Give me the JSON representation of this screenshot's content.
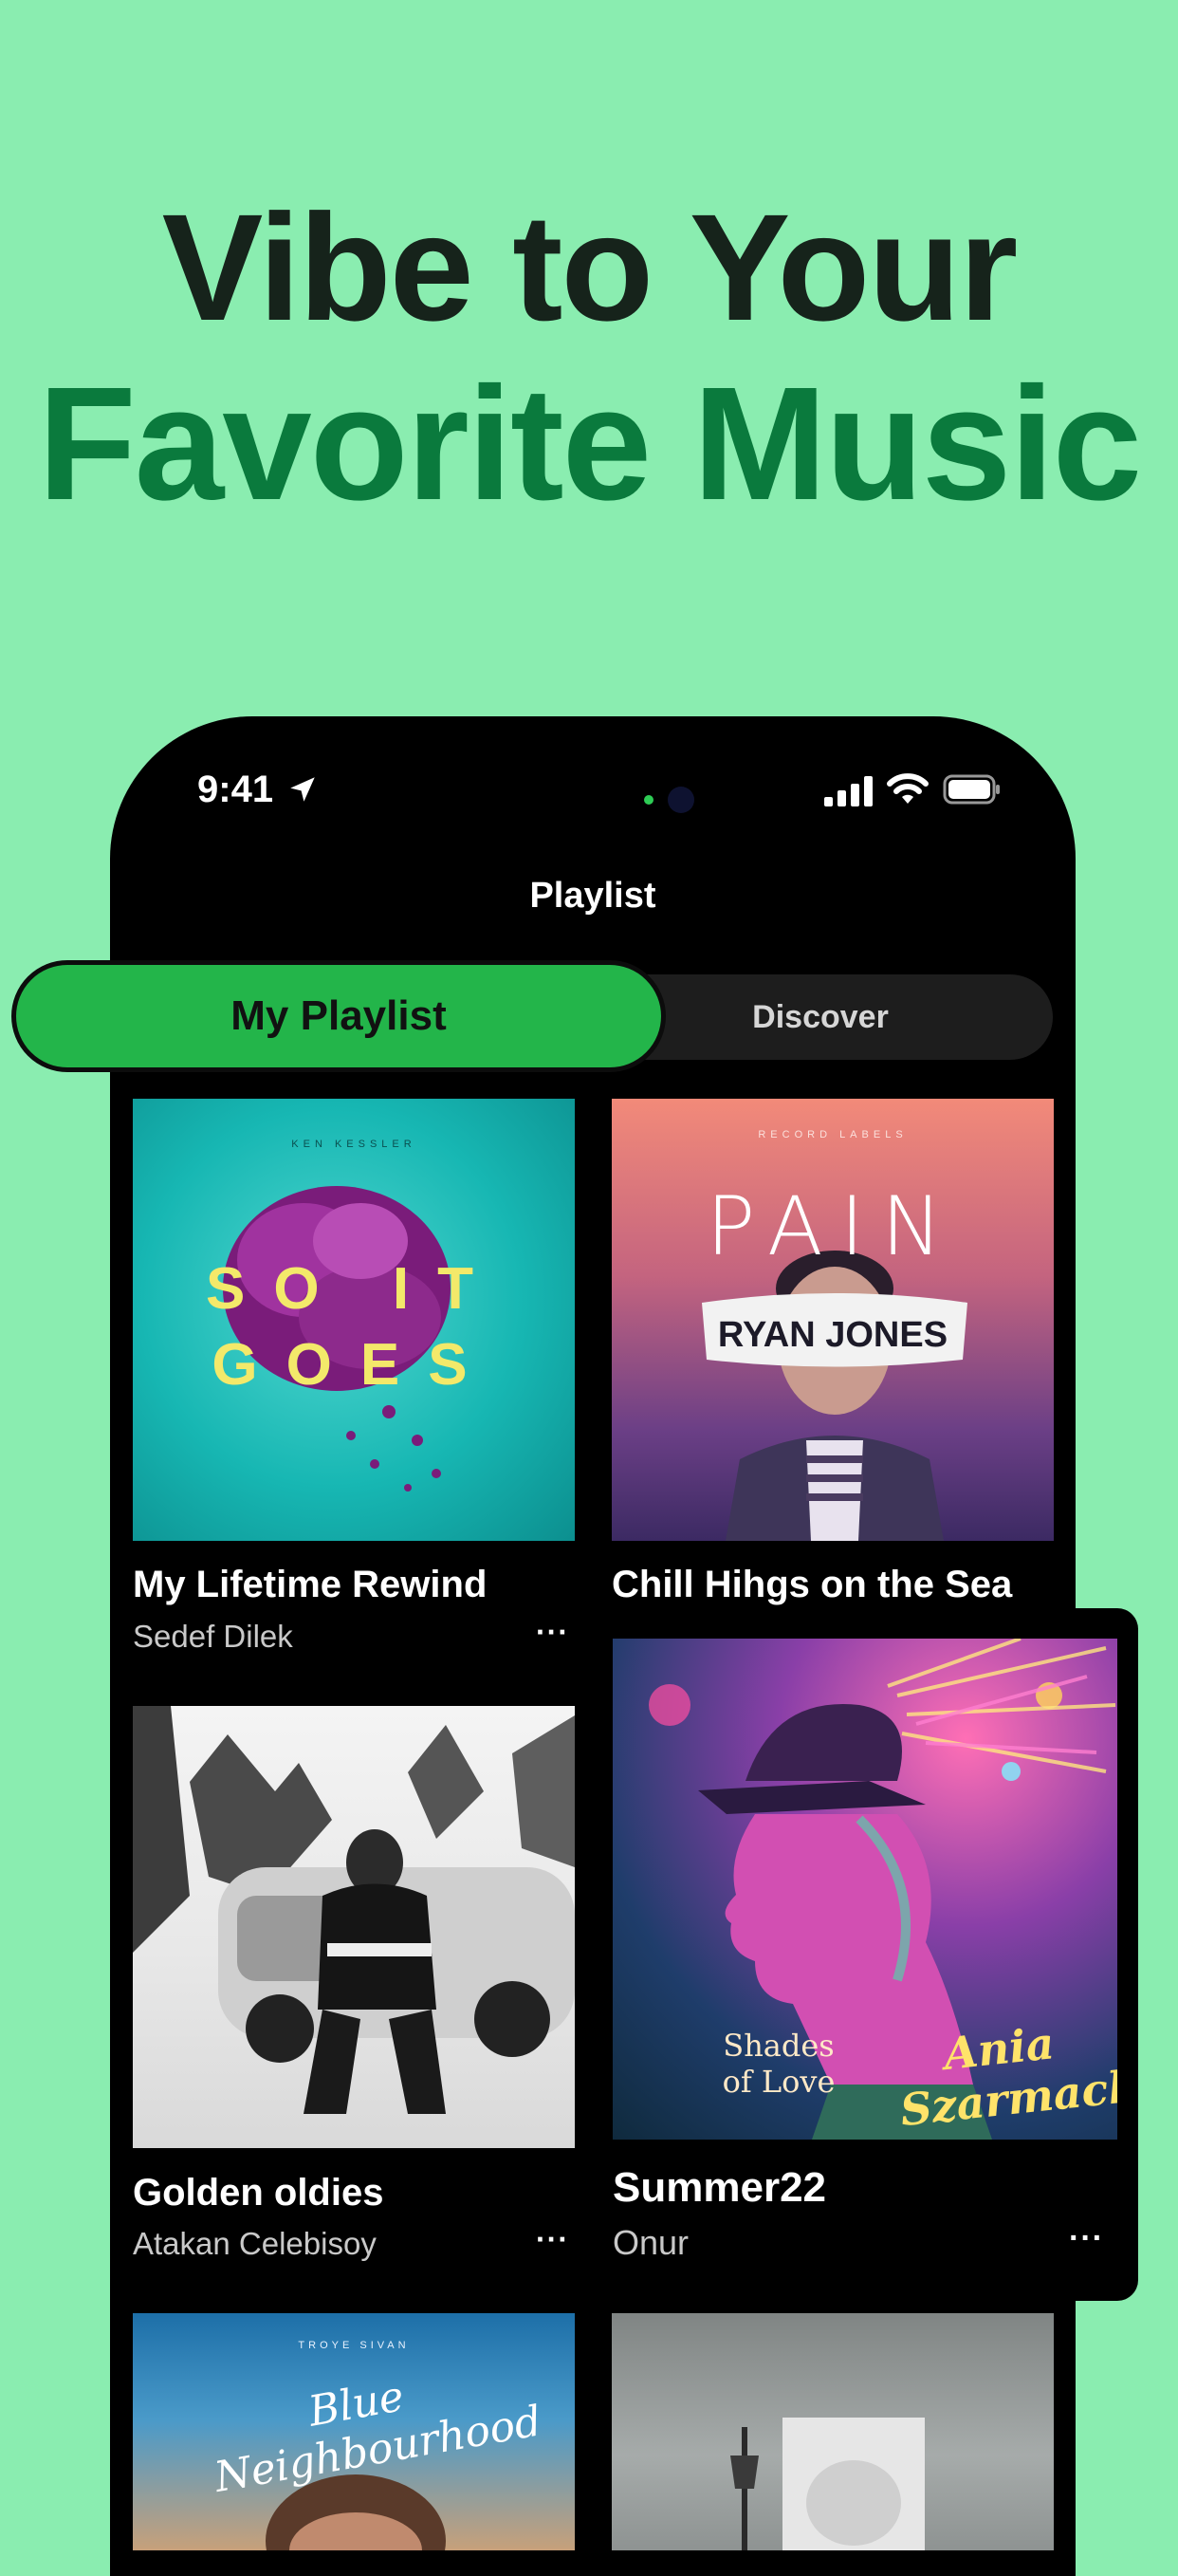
{
  "headline": {
    "line1": "Vibe to Your",
    "line2": "Favorite Music"
  },
  "status_bar": {
    "time": "9:41"
  },
  "screen": {
    "title": "Playlist"
  },
  "tabs": {
    "active": "My Playlist",
    "inactive": "Discover"
  },
  "playlists": [
    {
      "title": "My Lifetime Rewind",
      "subtitle": "Sedef Dilek",
      "cover_small": "KEN KESSLER",
      "cover_words": [
        "SO IT",
        "GOES"
      ]
    },
    {
      "title": "Chill Hihgs on the Sea",
      "subtitle": "",
      "cover_small": "RECORD LABELS",
      "cover_words": [
        "PAIN",
        "RYAN JONES"
      ]
    },
    {
      "title": "Golden oldies",
      "subtitle": "Atakan Celebisoy",
      "cover_small": "",
      "cover_words": []
    },
    {
      "title": "Summer22",
      "subtitle": "Onur",
      "cover_small": "",
      "cover_words": [
        "Shades of Love",
        "Ania Szarmach"
      ]
    },
    {
      "title": "",
      "subtitle": "",
      "cover_small": "TROYE SIVAN",
      "cover_words": [
        "Blue Neighbourhood"
      ]
    },
    {
      "title": "",
      "subtitle": "",
      "cover_small": "",
      "cover_words": []
    }
  ],
  "more_label": "···",
  "colors": {
    "background": "#8aedb0",
    "accent": "#23b54a",
    "headline_dark": "#16231b",
    "headline_green": "#0a7a3d"
  }
}
